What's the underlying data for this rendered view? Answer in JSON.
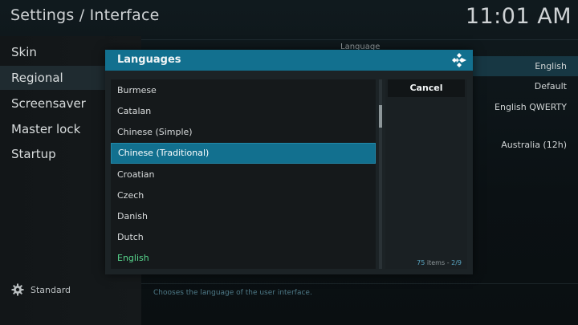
{
  "header": {
    "title": "Settings / Interface",
    "clock": "11:01 AM"
  },
  "sidebar": {
    "items": [
      {
        "label": "Skin"
      },
      {
        "label": "Regional"
      },
      {
        "label": "Screensaver"
      },
      {
        "label": "Master lock"
      },
      {
        "label": "Startup"
      }
    ],
    "active_index": 1,
    "footer": {
      "label": "Standard",
      "icon": "gear-icon"
    }
  },
  "background_panel": {
    "heading": "Language",
    "values": [
      "English",
      "Default",
      "English QWERTY",
      "Australia (12h)"
    ],
    "info_text": "Chooses the language of the user interface."
  },
  "dialog": {
    "title": "Languages",
    "logo_icon": "kodi-logo-icon",
    "items": [
      {
        "label": "Burmese"
      },
      {
        "label": "Catalan"
      },
      {
        "label": "Chinese (Simple)"
      },
      {
        "label": "Chinese (Traditional)"
      },
      {
        "label": "Croatian"
      },
      {
        "label": "Czech"
      },
      {
        "label": "Danish"
      },
      {
        "label": "Dutch"
      },
      {
        "label": "English"
      }
    ],
    "focused_index": 3,
    "current_index": 8,
    "cancel_label": "Cancel",
    "count": {
      "total": "75",
      "items_word": " items - ",
      "page": "2/9"
    },
    "scroll_position_fraction": 0.14
  },
  "colors": {
    "accent": "#12708f",
    "selected_text": "#58d68d",
    "count_highlight": "#5aa6c3"
  }
}
